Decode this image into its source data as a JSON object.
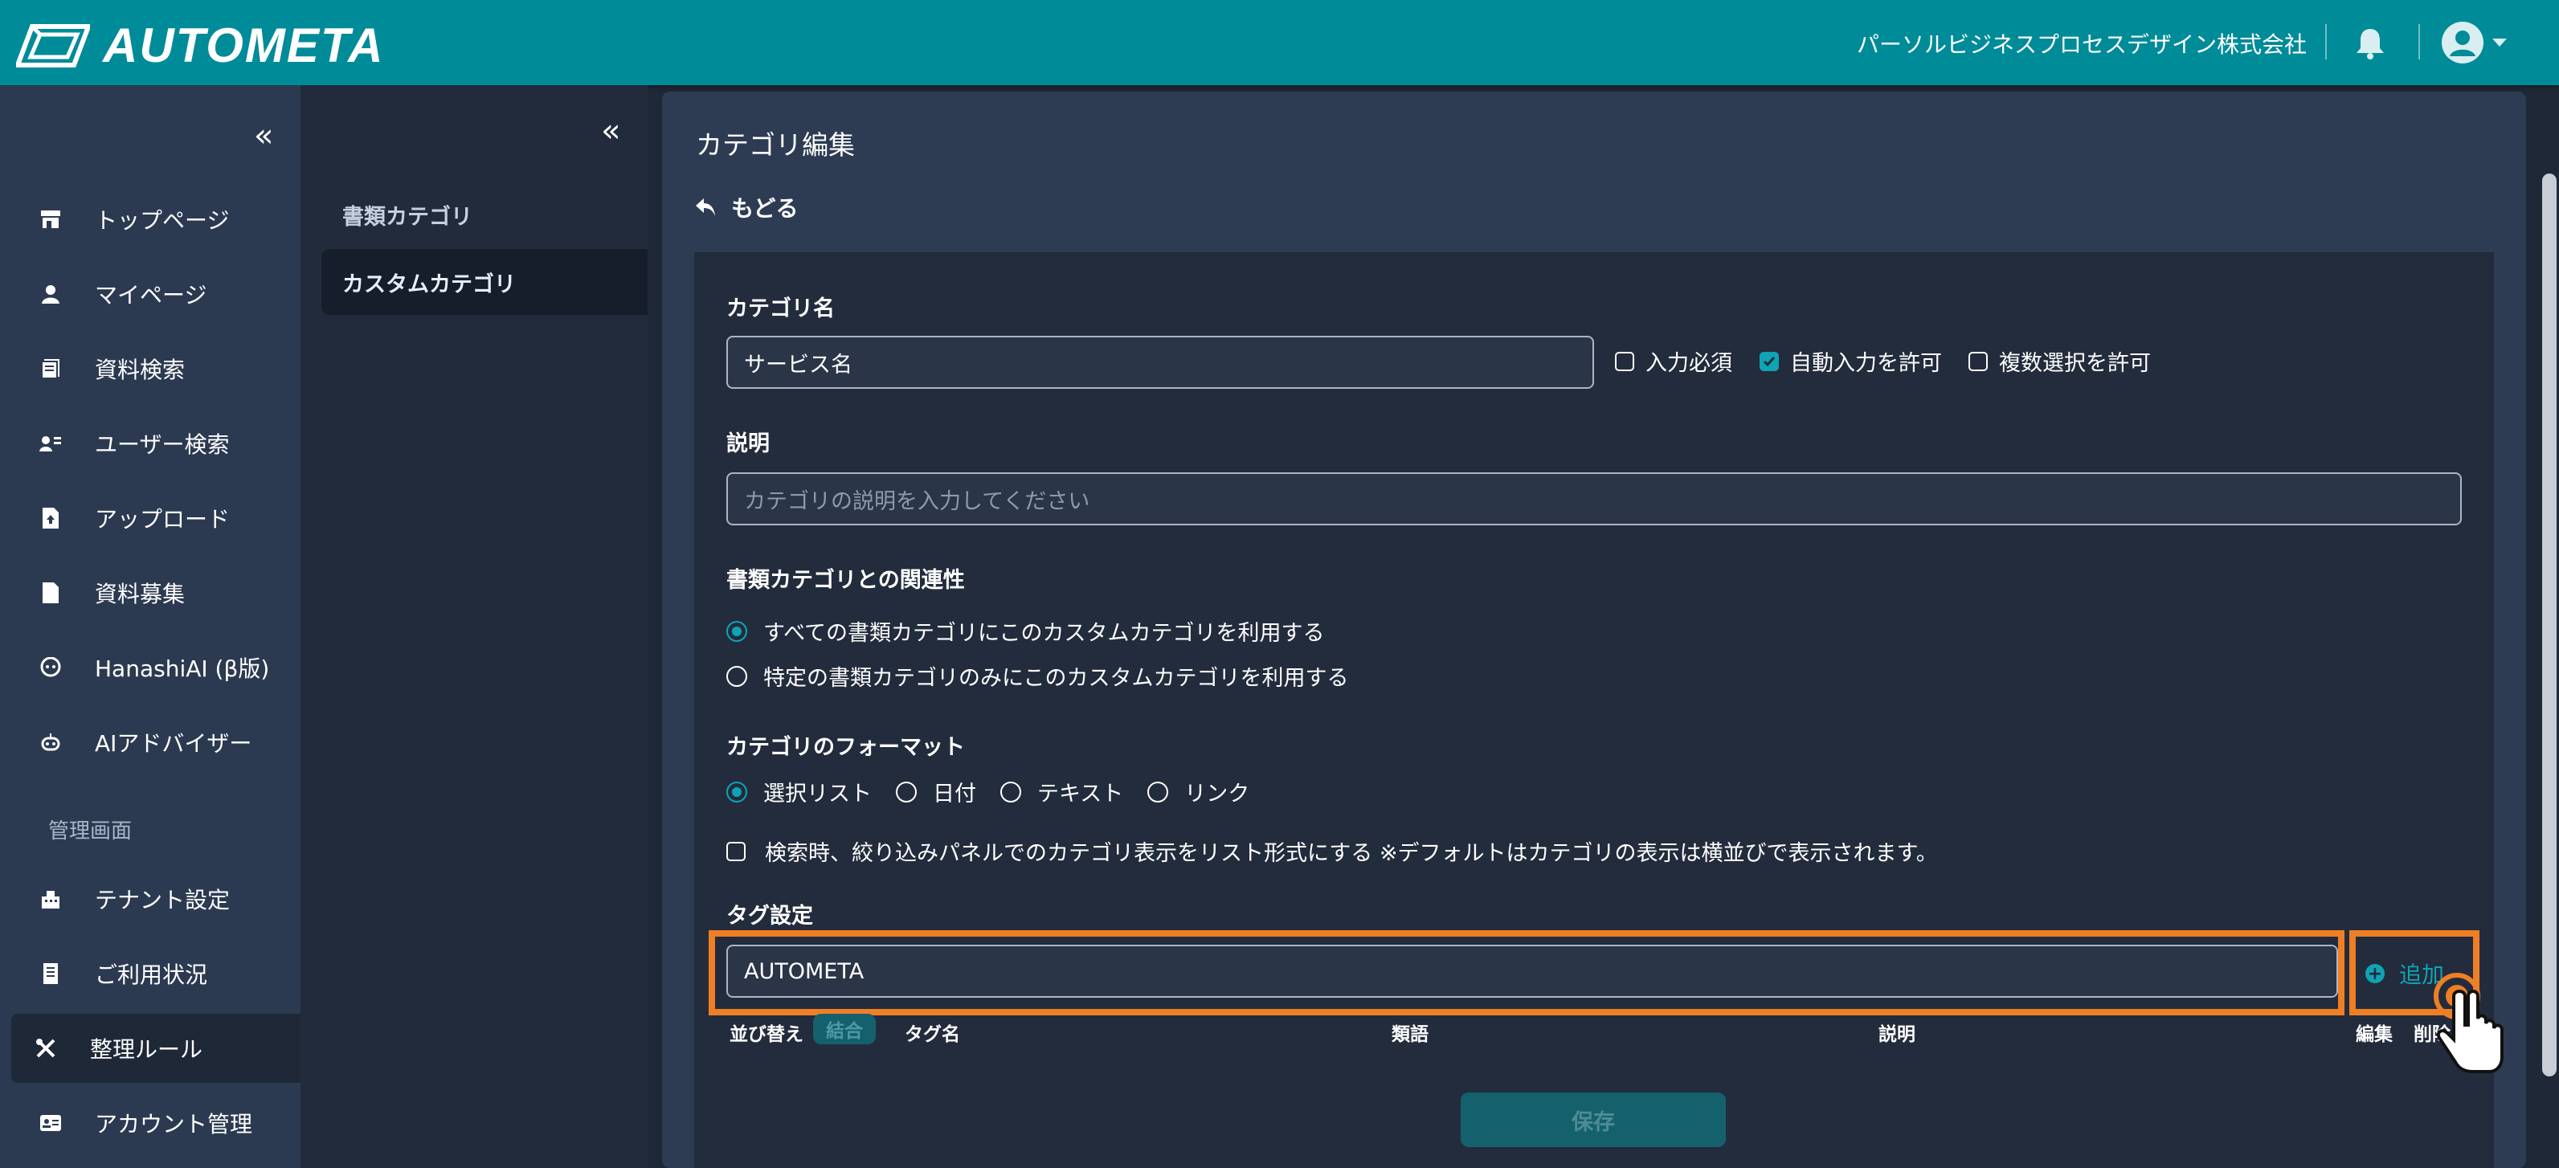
{
  "header": {
    "logo_text": "AUTOMETA",
    "company": "パーソルビジネスプロセスデザイン株式会社"
  },
  "sidebar": {
    "items": [
      {
        "label": "トップページ",
        "icon": "store-icon"
      },
      {
        "label": "マイページ",
        "icon": "person-icon"
      },
      {
        "label": "資料検索",
        "icon": "document-search-icon"
      },
      {
        "label": "ユーザー検索",
        "icon": "user-search-icon"
      },
      {
        "label": "アップロード",
        "icon": "file-upload-icon"
      },
      {
        "label": "資料募集",
        "icon": "file-icon"
      },
      {
        "label": "HanashiAI (β版)",
        "icon": "chat-icon"
      },
      {
        "label": "AIアドバイザー",
        "icon": "robot-icon"
      }
    ],
    "section_label": "管理画面",
    "admin_items": [
      {
        "label": "テナント設定",
        "icon": "building-icon"
      },
      {
        "label": "ご利用状況",
        "icon": "receipt-icon"
      },
      {
        "label": "整理ルール",
        "icon": "tools-icon",
        "active": true
      },
      {
        "label": "アカウント管理",
        "icon": "id-card-icon"
      }
    ]
  },
  "subnav": {
    "items": [
      {
        "label": "書類カテゴリ"
      },
      {
        "label": "カスタムカテゴリ",
        "active": true
      }
    ]
  },
  "main": {
    "title": "カテゴリ編集",
    "back_label": "もどる",
    "category_name_label": "カテゴリ名",
    "category_name_value": "サービス名",
    "checkboxes": [
      {
        "label": "入力必須",
        "checked": false
      },
      {
        "label": "自動入力を許可",
        "checked": true
      },
      {
        "label": "複数選択を許可",
        "checked": false
      }
    ],
    "description_label": "説明",
    "description_placeholder": "カテゴリの説明を入力してください",
    "relation_label": "書類カテゴリとの関連性",
    "relation_options": [
      {
        "label": "すべての書類カテゴリにこのカスタムカテゴリを利用する",
        "checked": true
      },
      {
        "label": "特定の書類カテゴリのみにこのカスタムカテゴリを利用する",
        "checked": false
      }
    ],
    "format_label": "カテゴリのフォーマット",
    "format_options": [
      {
        "label": "選択リスト",
        "checked": true
      },
      {
        "label": "日付",
        "checked": false
      },
      {
        "label": "テキスト",
        "checked": false
      },
      {
        "label": "リンク",
        "checked": false
      }
    ],
    "list_format_checkbox": "検索時、絞り込みパネルでのカテゴリ表示をリスト形式にする ※デフォルトはカテゴリの表示は横並びで表示されます。",
    "tag_label": "タグ設定",
    "tag_input_value": "AUTOMETA",
    "add_label": "追加",
    "table_headers": {
      "sort": "並び替え",
      "merge": "結合",
      "tag_name": "タグ名",
      "synonym": "類語",
      "description": "説明",
      "edit": "編集",
      "delete": "削除"
    },
    "save_label": "保存"
  },
  "colors": {
    "header": "#008b98",
    "accent": "#0fa3b4",
    "highlight": "#ef7f24",
    "sidebar": "#2c3a51",
    "panel": "#2e3c53"
  }
}
